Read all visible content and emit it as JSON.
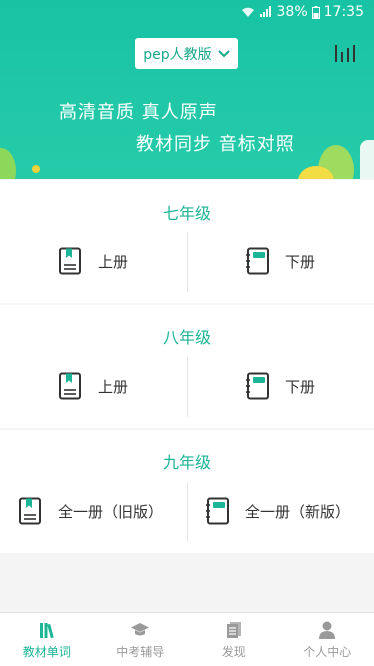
{
  "status_bar": {
    "battery": "38%",
    "time": "17:35"
  },
  "header": {
    "edition_label": "pep人教版",
    "slogan_line1": "高清音质 真人原声",
    "slogan_line2": "教材同步 音标对照"
  },
  "grades": [
    {
      "title": "七年级",
      "left": "上册",
      "right": "下册"
    },
    {
      "title": "八年级",
      "left": "上册",
      "right": "下册"
    },
    {
      "title": "九年级",
      "left": "全一册（旧版）",
      "right": "全一册（新版）"
    }
  ],
  "tabs": [
    {
      "label": "教材单词",
      "icon": "books-icon",
      "active": true
    },
    {
      "label": "中考辅导",
      "icon": "graduation-cap-icon",
      "active": false
    },
    {
      "label": "发现",
      "icon": "document-icon",
      "active": false
    },
    {
      "label": "个人中心",
      "icon": "person-icon",
      "active": false
    }
  ],
  "colors": {
    "primary": "#1cb596",
    "header_bg": "#21c8a8",
    "page_bg": "#f4f4f4"
  }
}
